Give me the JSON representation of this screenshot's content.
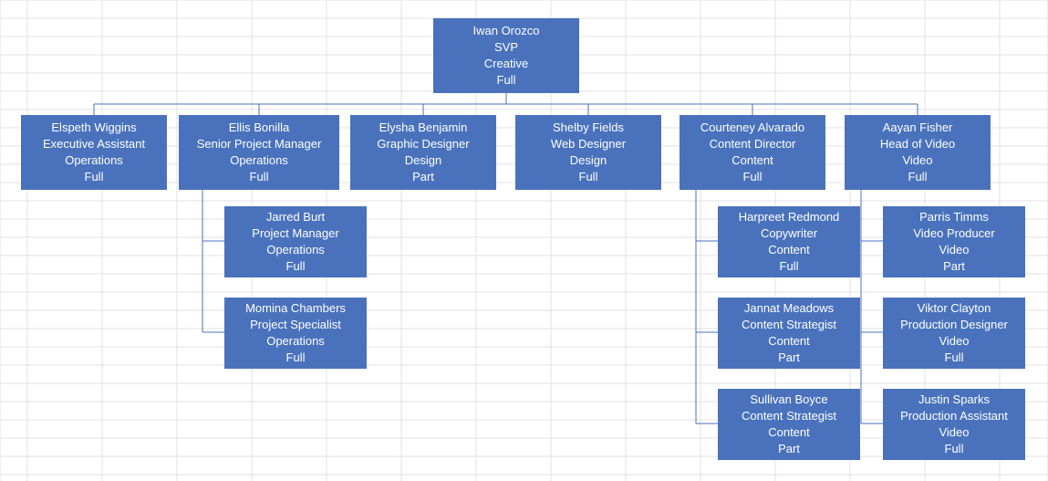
{
  "colors": {
    "node_fill": "#4a72bc",
    "node_text": "#ffffff",
    "grid": "#e0e0e0"
  },
  "chart_data": {
    "type": "org-chart",
    "root": "iwan_orozco",
    "people": {
      "iwan_orozco": {
        "name": "Iwan Orozco",
        "title": "SVP",
        "department": "Creative",
        "status": "Full",
        "reports": [
          "elspeth_wiggins",
          "ellis_bonilla",
          "elysha_benjamin",
          "shelby_fields",
          "courteney_alvarado",
          "aayan_fisher"
        ]
      },
      "elspeth_wiggins": {
        "name": "Elspeth Wiggins",
        "title": "Executive Assistant",
        "department": "Operations",
        "status": "Full",
        "reports": []
      },
      "ellis_bonilla": {
        "name": "Ellis Bonilla",
        "title": "Senior Project Manager",
        "department": "Operations",
        "status": "Full",
        "reports": [
          "jarred_burt",
          "momina_chambers"
        ]
      },
      "elysha_benjamin": {
        "name": "Elysha Benjamin",
        "title": "Graphic Designer",
        "department": "Design",
        "status": "Part",
        "reports": []
      },
      "shelby_fields": {
        "name": "Shelby Fields",
        "title": "Web Designer",
        "department": "Design",
        "status": "Full",
        "reports": []
      },
      "courteney_alvarado": {
        "name": "Courteney Alvarado",
        "title": "Content Director",
        "department": "Content",
        "status": "Full",
        "reports": [
          "harpreet_redmond",
          "jannat_meadows",
          "sullivan_boyce"
        ]
      },
      "aayan_fisher": {
        "name": "Aayan Fisher",
        "title": "Head of Video",
        "department": "Video",
        "status": "Full",
        "reports": [
          "parris_timms",
          "viktor_clayton",
          "justin_sparks"
        ]
      },
      "jarred_burt": {
        "name": "Jarred Burt",
        "title": "Project Manager",
        "department": "Operations",
        "status": "Full",
        "reports": []
      },
      "momina_chambers": {
        "name": "Momina Chambers",
        "title": "Project Specialist",
        "department": "Operations",
        "status": "Full",
        "reports": []
      },
      "harpreet_redmond": {
        "name": "Harpreet Redmond",
        "title": "Copywriter",
        "department": "Content",
        "status": "Full",
        "reports": []
      },
      "jannat_meadows": {
        "name": "Jannat Meadows",
        "title": "Content Strategist",
        "department": "Content",
        "status": "Part",
        "reports": []
      },
      "sullivan_boyce": {
        "name": "Sullivan Boyce",
        "title": "Content Strategist",
        "department": "Content",
        "status": "Part",
        "reports": []
      },
      "parris_timms": {
        "name": "Parris Timms",
        "title": "Video Producer",
        "department": "Video",
        "status": "Part",
        "reports": []
      },
      "viktor_clayton": {
        "name": "Viktor Clayton",
        "title": "Production Designer",
        "department": "Video",
        "status": "Full",
        "reports": []
      },
      "justin_sparks": {
        "name": "Justin Sparks",
        "title": "Production Assistant",
        "department": "Video",
        "status": "Full",
        "reports": []
      }
    }
  },
  "nodes": {
    "iwan_orozco": {
      "name": "Iwan Orozco",
      "title": "SVP",
      "department": "Creative",
      "status": "Full"
    },
    "elspeth_wiggins": {
      "name": "Elspeth Wiggins",
      "title": "Executive Assistant",
      "department": "Operations",
      "status": "Full"
    },
    "ellis_bonilla": {
      "name": "Ellis Bonilla",
      "title": "Senior Project Manager",
      "department": "Operations",
      "status": "Full"
    },
    "elysha_benjamin": {
      "name": "Elysha Benjamin",
      "title": "Graphic Designer",
      "department": "Design",
      "status": "Part"
    },
    "shelby_fields": {
      "name": "Shelby Fields",
      "title": "Web Designer",
      "department": "Design",
      "status": "Full"
    },
    "courteney_alvarado": {
      "name": "Courteney Alvarado",
      "title": "Content Director",
      "department": "Content",
      "status": "Full"
    },
    "aayan_fisher": {
      "name": "Aayan Fisher",
      "title": "Head of Video",
      "department": "Video",
      "status": "Full"
    },
    "jarred_burt": {
      "name": "Jarred Burt",
      "title": "Project Manager",
      "department": "Operations",
      "status": "Full"
    },
    "momina_chambers": {
      "name": "Momina Chambers",
      "title": "Project Specialist",
      "department": "Operations",
      "status": "Full"
    },
    "harpreet_redmond": {
      "name": "Harpreet Redmond",
      "title": "Copywriter",
      "department": "Content",
      "status": "Full"
    },
    "jannat_meadows": {
      "name": "Jannat Meadows",
      "title": "Content Strategist",
      "department": "Content",
      "status": "Part"
    },
    "sullivan_boyce": {
      "name": "Sullivan Boyce",
      "title": "Content Strategist",
      "department": "Content",
      "status": "Part"
    },
    "parris_timms": {
      "name": "Parris Timms",
      "title": "Video Producer",
      "department": "Video",
      "status": "Part"
    },
    "viktor_clayton": {
      "name": "Viktor Clayton",
      "title": "Production Designer",
      "department": "Video",
      "status": "Full"
    },
    "justin_sparks": {
      "name": "Justin Sparks",
      "title": "Production Assistant",
      "department": "Video",
      "status": "Full"
    }
  }
}
